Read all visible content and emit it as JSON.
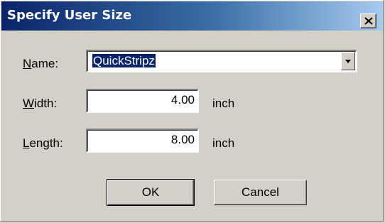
{
  "window": {
    "title": "Specify User Size",
    "close_glyph": "close-icon"
  },
  "form": {
    "name": {
      "label_mnemonic": "N",
      "label_rest": "ame:",
      "value": "QuickStripz"
    },
    "width": {
      "label_mnemonic": "W",
      "label_rest": "idth:",
      "value": "4.00",
      "unit": "inch"
    },
    "length": {
      "label_mnemonic": "L",
      "label_rest": "ength:",
      "value": "8.00",
      "unit": "inch"
    }
  },
  "buttons": {
    "ok_label": "OK",
    "cancel_label": "Cancel"
  },
  "colors": {
    "title_bar_start": "#0a246a",
    "title_bar_end": "#a6caf0",
    "face": "#d4d0c8",
    "selection": "#0a246a"
  }
}
